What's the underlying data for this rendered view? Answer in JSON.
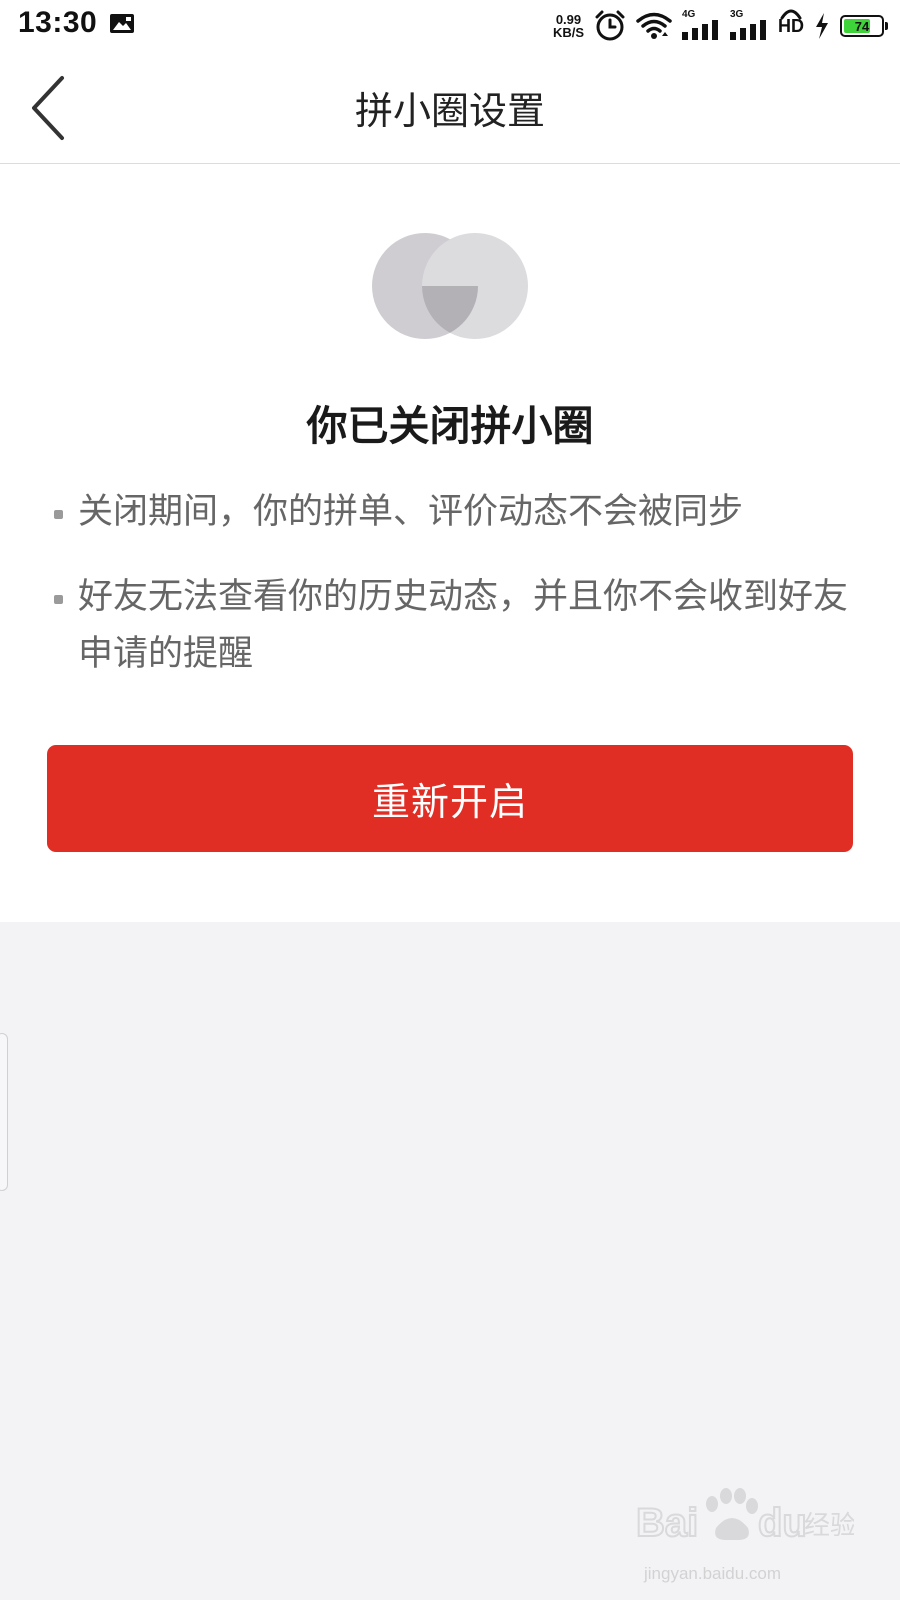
{
  "status_bar": {
    "time": "13:30",
    "net_speed_value": "0.99",
    "net_speed_unit": "KB/S",
    "signal_1_label": "4G",
    "signal_2_label": "3G",
    "hd_label": "HD",
    "battery_level": "74",
    "battery_color": "#3fd33a"
  },
  "nav": {
    "title": "拼小圈设置",
    "back_icon": "chevron-left-icon"
  },
  "content": {
    "status_icon": "overlapping-circles-icon",
    "title": "你已关闭拼小圈",
    "bullets": [
      "关闭期间，你的拼单、评价动态不会被同步",
      "好友无法查看你的历史动态，并且你不会收到好友申请的提醒"
    ],
    "button_label": "重新开启",
    "button_color": "#e02e24"
  },
  "watermark": {
    "logo_text": "Bai 经验",
    "url": "jingyan.baidu.com"
  }
}
